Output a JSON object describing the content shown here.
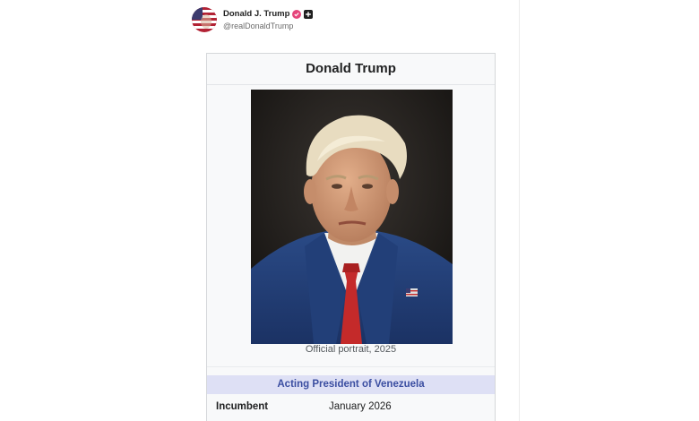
{
  "post": {
    "display_name": "Donald J. Trump",
    "handle": "@realDonaldTrump",
    "avatar_icon": "flag-avatar-icon",
    "verified_icon": "verified-badge-icon",
    "plus_icon": "plus-badge-icon",
    "colors": {
      "verified": "#e5457b",
      "plus": "#1f1f1f"
    }
  },
  "infobox": {
    "title": "Donald Trump",
    "caption": "Official portrait, 2025",
    "section_header": "Acting President of Venezuela",
    "rows": [
      {
        "label": "Incumbent",
        "value": "January 2026"
      }
    ],
    "colors": {
      "section_bg": "#dee0f5",
      "section_text": "#3b4ea1",
      "box_bg": "#f8f9fa"
    }
  }
}
